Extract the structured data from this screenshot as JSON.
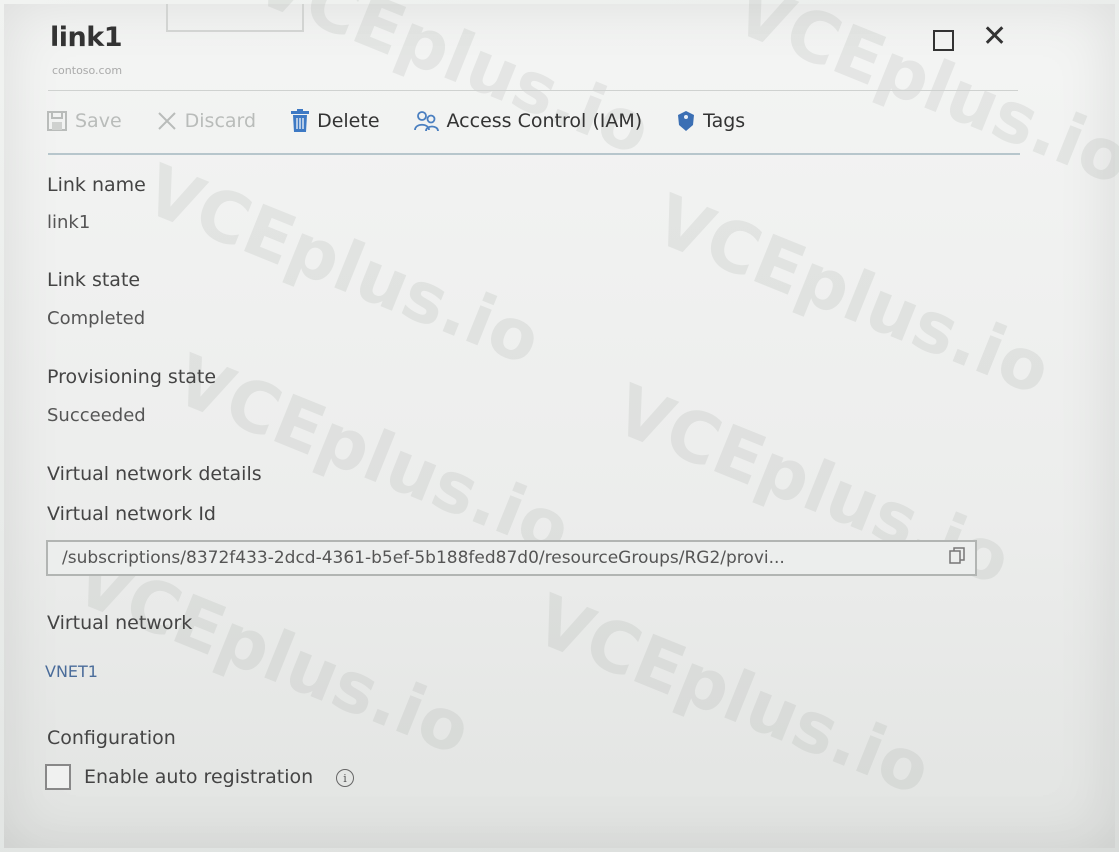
{
  "panel": {
    "title": "link1",
    "subtitle": "contoso.com"
  },
  "toolbar": {
    "save_label": "Save",
    "discard_label": "Discard",
    "delete_label": "Delete",
    "iam_label": "Access Control (IAM)",
    "tags_label": "Tags"
  },
  "fields": {
    "link_name_label": "Link name",
    "link_name_value": "link1",
    "link_state_label": "Link state",
    "link_state_value": "Completed",
    "provisioning_label": "Provisioning state",
    "provisioning_value": "Succeeded",
    "vnet_details_heading": "Virtual network details",
    "vnet_id_label": "Virtual network Id",
    "vnet_id_value": "/subscriptions/8372f433-2dcd-4361-b5ef-5b188fed87d0/resourceGroups/RG2/provi...",
    "vnet_label": "Virtual network",
    "vnet_value": "VNET1",
    "configuration_label": "Configuration",
    "auto_registration_label": "Enable auto registration",
    "auto_registration_checked": false
  },
  "watermark": "VCEplus.io",
  "colors": {
    "link": "#4a6c9a",
    "delete_icon": "#3d79c4",
    "iam_icon": "#4a7fc0",
    "tags_icon": "#3b6fb4",
    "accent_line": "#b7c6cc"
  },
  "icons": {
    "save": "save-icon",
    "discard": "discard-x-icon",
    "delete": "trash-icon",
    "iam": "people-icon",
    "tags": "tag-icon",
    "copy": "copy-icon",
    "info": "info-icon",
    "maximize": "maximize-icon",
    "close": "close-icon"
  }
}
